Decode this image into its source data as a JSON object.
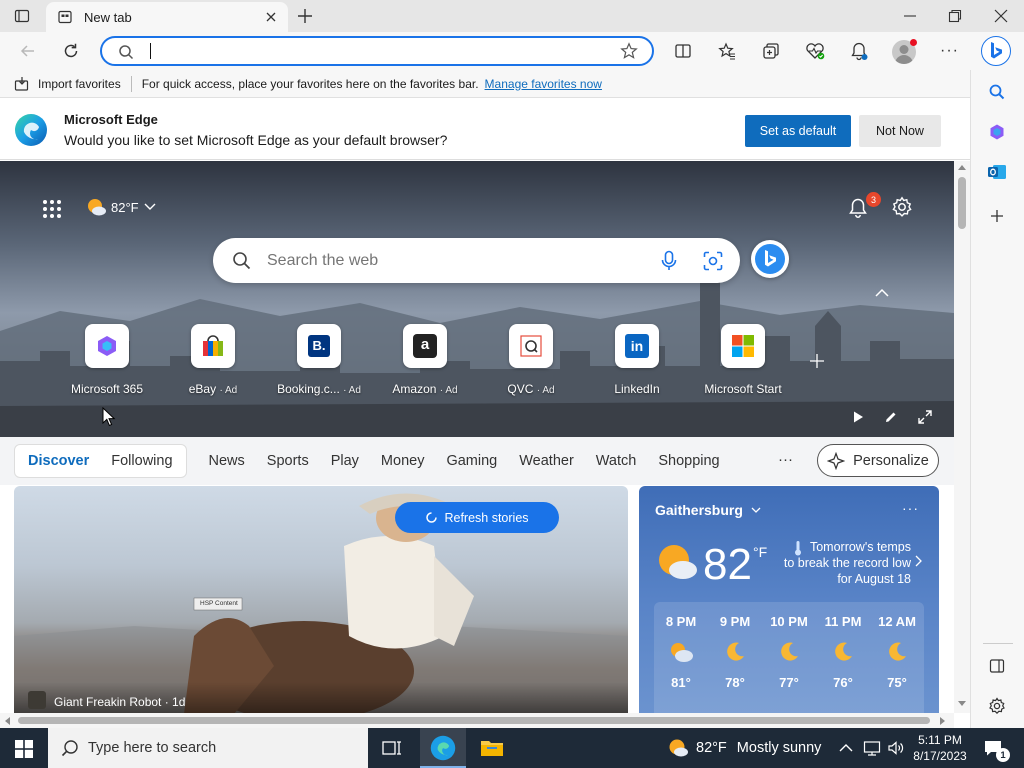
{
  "browser": {
    "tab_title": "New tab",
    "address_value": "",
    "favorites_bar": {
      "import_label": "Import favorites",
      "message": "For quick access, place your favorites here on the favorites bar.",
      "manage_link": "Manage favorites now"
    },
    "default_prompt": {
      "title": "Microsoft Edge",
      "message": "Would you like to set Microsoft Edge as your default browser?",
      "set_default_label": "Set as default",
      "not_now_label": "Not Now"
    },
    "profile_badge_color": "#e81123"
  },
  "newtab": {
    "weather_temp": "82°F",
    "notifications_count": "3",
    "search_placeholder": "Search the web",
    "quick_links": [
      {
        "label": "Microsoft 365",
        "ad": ""
      },
      {
        "label": "eBay",
        "ad": "· Ad"
      },
      {
        "label": "Booking.c...",
        "ad": "· Ad"
      },
      {
        "label": "Amazon",
        "ad": "· Ad"
      },
      {
        "label": "QVC",
        "ad": "· Ad"
      },
      {
        "label": "LinkedIn",
        "ad": ""
      },
      {
        "label": "Microsoft Start",
        "ad": ""
      }
    ],
    "feed_tabs": {
      "discover": "Discover",
      "following": "Following",
      "items": [
        "News",
        "Sports",
        "Play",
        "Money",
        "Gaming",
        "Weather",
        "Watch",
        "Shopping"
      ],
      "more": "···",
      "personalize": "Personalize"
    },
    "news_card": {
      "refresh_label": "Refresh stories",
      "sign_text": "HSP Content",
      "source": "Giant Freakin Robot · 1d"
    },
    "weather_card": {
      "location": "Gaithersburg",
      "temp": "82",
      "unit": "°F",
      "alert": "Tomorrow's temps to break the record low for August 18",
      "hours": [
        {
          "time": "8 PM",
          "temp": "81°",
          "icon": "partly-cloudy-night-icon"
        },
        {
          "time": "9 PM",
          "temp": "78°",
          "icon": "moon-icon"
        },
        {
          "time": "10 PM",
          "temp": "77°",
          "icon": "moon-icon"
        },
        {
          "time": "11 PM",
          "temp": "76°",
          "icon": "moon-icon"
        },
        {
          "time": "12 AM",
          "temp": "75°",
          "icon": "moon-icon"
        }
      ]
    }
  },
  "taskbar": {
    "search_placeholder": "Type here to search",
    "weather_temp": "82°F",
    "weather_desc": "Mostly sunny",
    "time": "5:11 PM",
    "date": "8/17/2023",
    "notification_count": "1"
  },
  "colors": {
    "accent": "#0f6cbd",
    "address_border": "#1a73e8",
    "discover": "#0f6cbd",
    "taskbar": "#1e2a38"
  }
}
